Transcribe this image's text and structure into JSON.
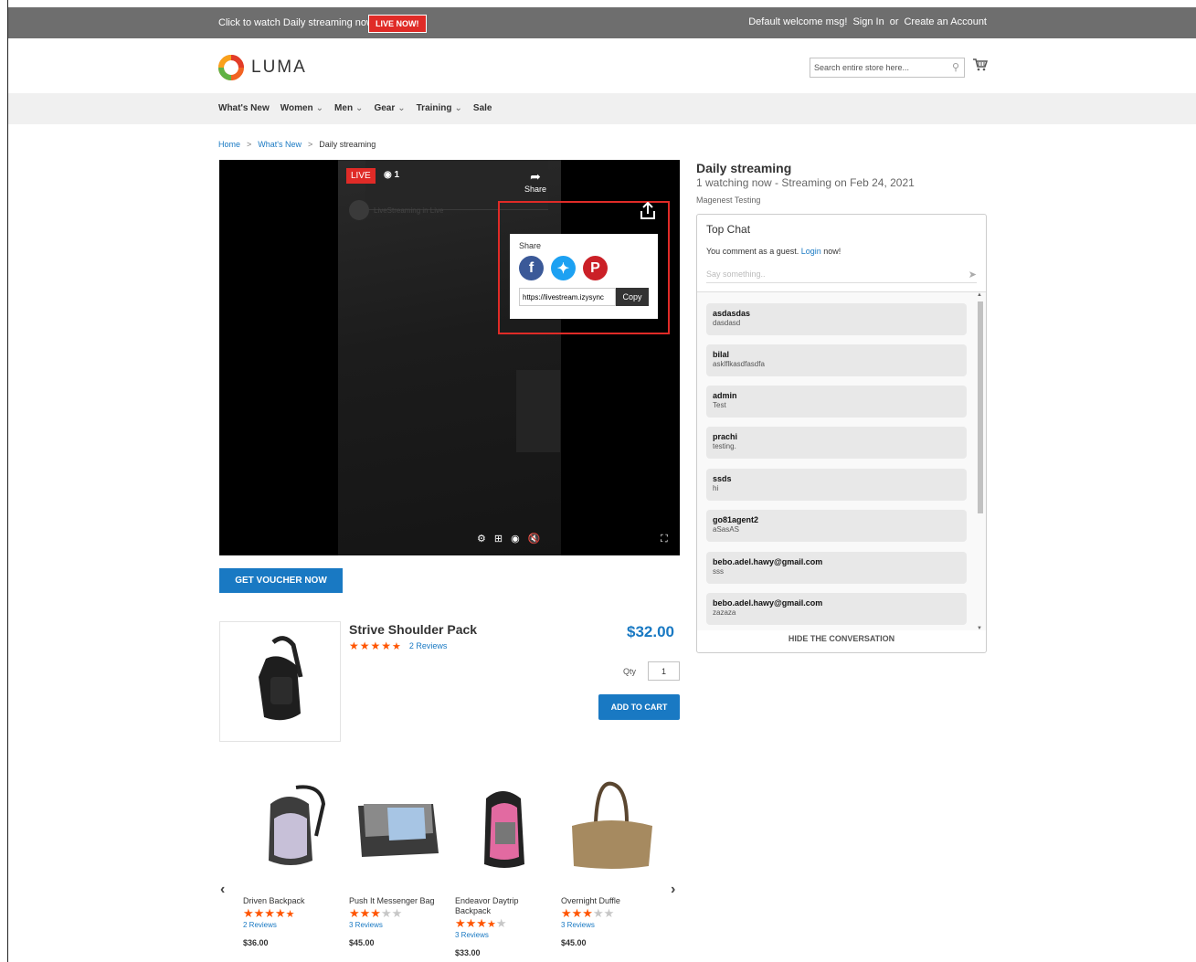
{
  "topbar": {
    "promo": "Click to watch Daily streaming now",
    "live_button": "LIVE NOW!",
    "welcome": "Default welcome msg!",
    "sign_in": "Sign In",
    "or": "or",
    "create_account": "Create an Account"
  },
  "header": {
    "logo_text": "LUMA",
    "search_placeholder": "Search entire store here..."
  },
  "nav": {
    "items": [
      {
        "label": "What's New",
        "has_dropdown": false
      },
      {
        "label": "Women",
        "has_dropdown": true
      },
      {
        "label": "Men",
        "has_dropdown": true
      },
      {
        "label": "Gear",
        "has_dropdown": true
      },
      {
        "label": "Training",
        "has_dropdown": true
      },
      {
        "label": "Sale",
        "has_dropdown": false
      }
    ]
  },
  "breadcrumb": [
    "Home",
    "What's New",
    "Daily streaming"
  ],
  "video": {
    "live_label": "LIVE",
    "viewers": "1",
    "share_label": "Share",
    "watermark": "LiveStreaming in Live",
    "share_popup": {
      "title": "Share",
      "url": "https://livestream.izysync",
      "copy_label": "Copy",
      "networks": [
        "facebook",
        "twitter",
        "pinterest"
      ]
    }
  },
  "voucher_button": "GET VOUCHER NOW",
  "product": {
    "name": "Strive Shoulder Pack",
    "rating": 4.5,
    "reviews": "2 Reviews",
    "price": "$32.00",
    "qty_label": "Qty",
    "qty": "1",
    "add_to_cart": "ADD TO CART"
  },
  "carousel": [
    {
      "name": "Driven Backpack",
      "rating": 4.5,
      "reviews": "2 Reviews",
      "price": "$36.00"
    },
    {
      "name": "Push It Messenger Bag",
      "rating": 3,
      "reviews": "3 Reviews",
      "price": "$45.00"
    },
    {
      "name": "Endeavor Daytrip Backpack",
      "rating": 3.5,
      "reviews": "3 Reviews",
      "price": "$33.00"
    },
    {
      "name": "Overnight Duffle",
      "rating": 3,
      "reviews": "3 Reviews",
      "price": "$45.00"
    }
  ],
  "stream": {
    "title": "Daily streaming",
    "subtitle": "1 watching now - Streaming on Feb 24, 2021",
    "host": "Magenest Testing"
  },
  "chat": {
    "title": "Top Chat",
    "guest_text": "You comment as a guest.",
    "login": "Login",
    "now": "now!",
    "placeholder": "Say something..",
    "messages": [
      {
        "user": "asdasdas",
        "text": "dasdasd"
      },
      {
        "user": "bilal",
        "text": "asklflkasdfasdfa"
      },
      {
        "user": "admin",
        "text": "Test"
      },
      {
        "user": "prachi",
        "text": "testing."
      },
      {
        "user": "ssds",
        "text": "hi"
      },
      {
        "user": "go81agent2",
        "text": "aSasAS"
      },
      {
        "user": "bebo.adel.hawy@gmail.com",
        "text": "sss"
      },
      {
        "user": "bebo.adel.hawy@gmail.com",
        "text": "zazaza"
      }
    ],
    "hide_label": "HIDE THE CONVERSATION"
  },
  "colors": {
    "accent": "#1979c3",
    "live_red": "#e02b27",
    "star": "#ff5501",
    "topbar": "#6e6e6e"
  }
}
